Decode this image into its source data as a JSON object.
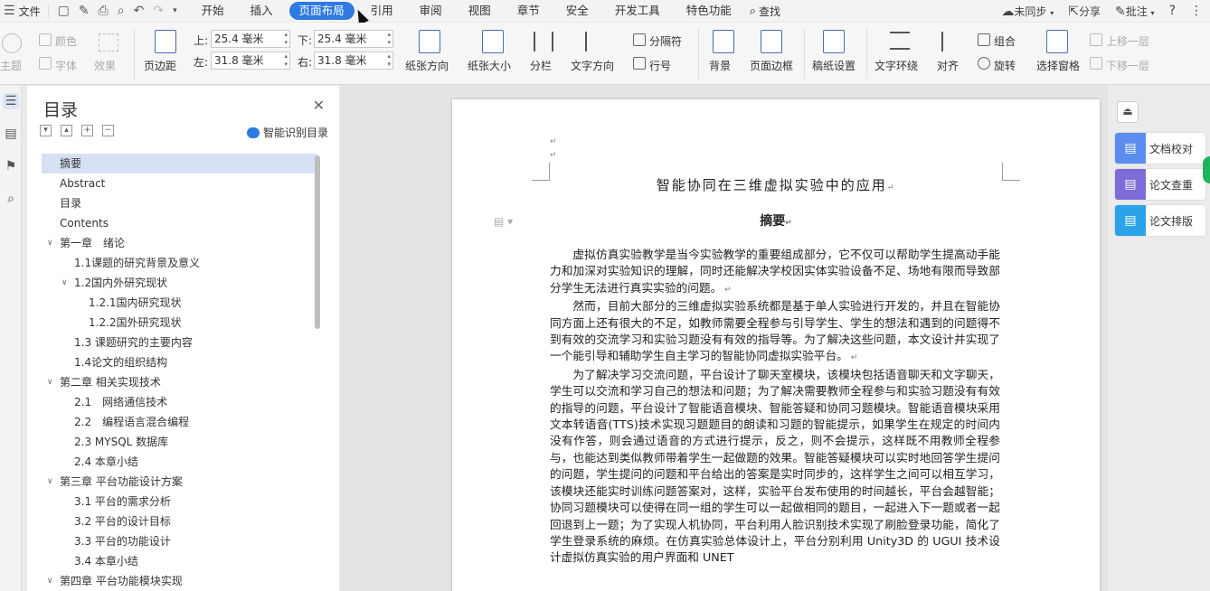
{
  "menubar": {
    "file": "文件",
    "tabs": [
      "开始",
      "插入",
      "页面布局",
      "引用",
      "审阅",
      "视图",
      "章节",
      "安全",
      "开发工具",
      "特色功能"
    ],
    "active_tab": "页面布局",
    "search": "查找",
    "sync": "未同步",
    "share": "分享",
    "comment": "批注",
    "help": "?"
  },
  "ribbon": {
    "color": "颜色",
    "theme": "主题",
    "font": "字体",
    "effect": "效果",
    "margins": "页边距",
    "top_label": "上:",
    "top_value": "25.4 毫米",
    "bottom_label": "下:",
    "bottom_value": "25.4 毫米",
    "left_label": "左:",
    "left_value": "31.8 毫米",
    "right_label": "右:",
    "right_value": "31.8 毫米",
    "orientation": "纸张方向",
    "size": "纸张大小",
    "columns": "分栏",
    "text_direction": "文字方向",
    "separator": "分隔符",
    "line_numbers": "行号",
    "background": "背景",
    "page_border": "页面边框",
    "manuscript": "稿纸设置",
    "text_wrap": "文字环绕",
    "align": "对齐",
    "group": "组合",
    "rotate": "旋转",
    "selection_pane": "选择窗格",
    "bring_forward": "上移一层",
    "send_backward": "下移一层"
  },
  "toc": {
    "title": "目录",
    "ai_label": "智能识别目录",
    "items": [
      {
        "label": "摘要",
        "level": 1,
        "arrow": false,
        "selected": true
      },
      {
        "label": "Abstract",
        "level": 1,
        "arrow": false
      },
      {
        "label": "目录",
        "level": 1,
        "arrow": false
      },
      {
        "label": "Contents",
        "level": 1,
        "arrow": false
      },
      {
        "label": "第一章　绪论",
        "level": 1,
        "arrow": true
      },
      {
        "label": "1.1课题的研究背景及意义",
        "level": 2,
        "arrow": false
      },
      {
        "label": "1.2国内外研究现状",
        "level": 2,
        "arrow": true
      },
      {
        "label": "1.2.1国内研究现状",
        "level": 3,
        "arrow": false
      },
      {
        "label": "1.2.2国外研究现状",
        "level": 3,
        "arrow": false
      },
      {
        "label": "1.3 课题研究的主要内容",
        "level": 2,
        "arrow": false
      },
      {
        "label": "1.4论文的组织结构",
        "level": 2,
        "arrow": false
      },
      {
        "label": "第二章 相关实现技术",
        "level": 1,
        "arrow": true
      },
      {
        "label": "2.1　网络通信技术",
        "level": 2,
        "arrow": false
      },
      {
        "label": "2.2　编程语言混合编程",
        "level": 2,
        "arrow": false
      },
      {
        "label": "2.3 MYSQL 数据库",
        "level": 2,
        "arrow": false
      },
      {
        "label": "2.4 本章小结",
        "level": 2,
        "arrow": false
      },
      {
        "label": "第三章 平台功能设计方案",
        "level": 1,
        "arrow": true
      },
      {
        "label": "3.1 平台的需求分析",
        "level": 2,
        "arrow": false
      },
      {
        "label": "3.2 平台的设计目标",
        "level": 2,
        "arrow": false
      },
      {
        "label": "3.3 平台的功能设计",
        "level": 2,
        "arrow": false
      },
      {
        "label": "3.4 本章小结",
        "level": 2,
        "arrow": false
      },
      {
        "label": "第四章 平台功能模块实现",
        "level": 1,
        "arrow": true
      }
    ]
  },
  "document": {
    "title": "智能协同在三维虚拟实验中的应用",
    "abstract_heading": "摘要",
    "paragraphs": [
      "虚拟仿真实验教学是当今实验教学的重要组成部分，它不仅可以帮助学生提高动手能力和加深对实验知识的理解，同时还能解决学校因实体实验设备不足、场地有限而导致部分学生无法进行真实实验的问题。",
      "然而，目前大部分的三维虚拟实验系统都是基于单人实验进行开发的，并且在智能协同方面上还有很大的不足，如教师需要全程参与引导学生、学生的想法和遇到的问题得不到有效的交流学习和实验习题没有有效的指导等。为了解决这些问题，本文设计并实现了一个能引导和辅助学生自主学习的智能协同虚拟实验平台。",
      "为了解决学习交流问题，平台设计了聊天室模块，该模块包括语音聊天和文字聊天，学生可以交流和学习自己的想法和问题；为了解决需要教师全程参与和实验习题没有有效的指导的问题，平台设计了智能语音模块、智能答疑和协同习题模块。智能语音模块采用文本转语音(TTS)技术实现习题题目的朗读和习题的智能提示，如果学生在规定的时间内没有作答，则会通过语音的方式进行提示，反之，则不会提示，这样既不用教师全程参与，也能达到类似教师带着学生一起做题的效果。智能答疑模块可以实时地回答学生提问的问题，学生提问的问题和平台给出的答案是实时同步的，这样学生之间可以相互学习，该模块还能实时训练问题答案对，这样，实验平台发布使用的时间越长，平台会越智能；协同习题模块可以使得在同一组的学生可以一起做相同的题目，一起进入下一题或者一起回退到上一题；为了实现人机协同，平台利用人脸识别技术实现了刷脸登录功能，简化了学生登录系统的麻烦。在仿真实验总体设计上，平台分别利用 Unity3D 的 UGUI 技术设计虚拟仿真实验的用户界面和 UNET"
    ]
  },
  "rightpanel": {
    "buttons": [
      {
        "label": "文档校对",
        "color": "#5b8def"
      },
      {
        "label": "论文查重",
        "color": "#7b6cd8"
      },
      {
        "label": "论文排版",
        "color": "#2aa3e8"
      }
    ]
  }
}
